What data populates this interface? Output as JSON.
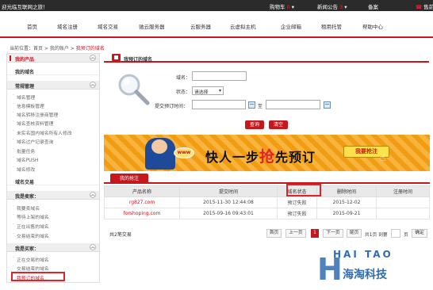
{
  "topbar": {
    "welcome": "迎光临互联网之旅！",
    "cart_label": "购物车",
    "cart_count": "0",
    "notice_label": "新闻公告",
    "notice_count": "3",
    "record_label": "备案",
    "phone_label": "售前"
  },
  "nav": [
    "首页",
    "域名注册",
    "域名交易",
    "驰云服务器",
    "云服务器",
    "云虚拟主机",
    "企业邮箱",
    "租用托管",
    "帮助中心"
  ],
  "breadcrumb": {
    "prefix": "当前位置：首页 > 我的账户 > ",
    "current": "我预订的域名"
  },
  "sidebar": {
    "my_products": "我的产品",
    "my_domains": "我的域名",
    "common_mgmt": "常规管理",
    "common_items": [
      "域名管理",
      "信息模板管理",
      "域名转移注册商管理",
      "域名查核资料管理",
      "未实名国内域名所有人修改",
      "域名过户记录查询",
      "批量任务",
      "域名PUSH",
      "域名修改"
    ],
    "domain_trade": "域名交易",
    "seller": "我是卖家：",
    "seller_items": [
      "我要卖域名",
      "等待上架的域名",
      "正在出售的域名",
      "交易结束的域名"
    ],
    "buyer": "我是买家：",
    "buyer_items": [
      "正在交易的域名",
      "交易结束的域名",
      "我预订的域名"
    ]
  },
  "section": {
    "title": "我预订的域名"
  },
  "form": {
    "domain_label": "域名：",
    "status_label": "状态：",
    "status_value": "请选择",
    "time_label": "提交预订时间：",
    "to_label": "至",
    "search_btn": "查询",
    "clear_btn": "清空"
  },
  "banner": {
    "www": "www",
    "slogan_a": "快人一步",
    "slogan_b": "抢",
    "slogan_c": "先预订",
    "go_btn": "我要抢注"
  },
  "tab": "我的抢注",
  "table": {
    "headers": [
      "产品名称",
      "提交时间",
      "域名状态",
      "删除时间",
      "注册时间"
    ],
    "rows": [
      [
        "rg827.com",
        "2015-11-30 12:44:08",
        "预订失败",
        "2015-12-02",
        ""
      ],
      [
        "forshoping.com",
        "2015-09-16 09:43:01",
        "预订失败",
        "2015-09-21",
        ""
      ]
    ]
  },
  "pager": {
    "count": "共2笔交易",
    "first": "首页",
    "prev": "上一页",
    "page": "1",
    "next": "下一页",
    "last": "尾页",
    "total": "共1页 到第",
    "unit": "页",
    "go": "确定"
  },
  "watermark": {
    "en": "HAI TAO",
    "cn": "海淘科技",
    "letter": "H"
  },
  "colors": {
    "accent": "#c8161d",
    "banner": "#f5a623",
    "watermark": "#2e6db4"
  }
}
